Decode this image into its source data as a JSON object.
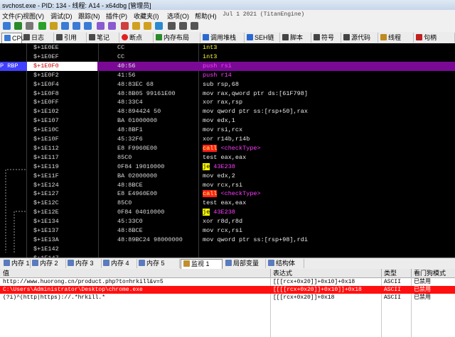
{
  "title": "svchost.exe - PID: 134 - 线程: A14 - x64dbg [管理员]",
  "menu": [
    "文件(F)",
    "视图(V)",
    "调试(D)",
    "跟踪(N)",
    "插件(P)",
    "收藏夹(I)",
    "选项(O)",
    "帮助(H)"
  ],
  "menu_date": "Jul 1 2021 (TitanEngine)",
  "tabs": [
    {
      "label": "CPU",
      "icon": "cpu-icon",
      "color": "#3a7bd5"
    },
    {
      "label": "日志",
      "icon": "log-icon",
      "color": "#4a4a4a"
    },
    {
      "label": "引用",
      "icon": "reference-icon",
      "color": "#4a4a4a"
    },
    {
      "label": "笔记",
      "icon": "notes-icon",
      "color": "#4a4a4a"
    },
    {
      "label": "断点",
      "icon": "breakpoint-icon",
      "color": "#e02020"
    },
    {
      "label": "内存布局",
      "icon": "memory-map-icon",
      "color": "#2a8a2a"
    },
    {
      "label": "调用堆栈",
      "icon": "call-stack-icon",
      "color": "#2a6ad0"
    },
    {
      "label": "SEH链",
      "icon": "seh-chain-icon",
      "color": "#2a6ad0"
    },
    {
      "label": "脚本",
      "icon": "script-icon",
      "color": "#444"
    },
    {
      "label": "符号",
      "icon": "symbols-icon",
      "color": "#444"
    },
    {
      "label": "源代码",
      "icon": "source-icon",
      "color": "#444"
    },
    {
      "label": "线程",
      "icon": "threads-icon",
      "color": "#c08a20"
    },
    {
      "label": "句柄",
      "icon": "handles-icon",
      "color": "#c02020"
    }
  ],
  "disasm": {
    "rip_label": "P RBP",
    "rows": [
      {
        "addr": "$+1E0EE",
        "bytes": "CC",
        "parts": [
          [
            "int3",
            "k-yel"
          ]
        ]
      },
      {
        "addr": "$+1E0EF",
        "bytes": "CC",
        "parts": [
          [
            "int3",
            "k-yel"
          ]
        ]
      },
      {
        "addr": "$+1E0F0",
        "bytes": "40:56",
        "parts": [
          [
            "push rsi",
            "k-mag"
          ]
        ],
        "sel": true
      },
      {
        "addr": "$+1E0F2",
        "bytes": "41:56",
        "parts": [
          [
            "push r14",
            "k-mag"
          ]
        ]
      },
      {
        "addr": "$+1E0F4",
        "bytes": "48:83EC 68",
        "parts": [
          [
            "sub rsp,68",
            "k-wht"
          ]
        ]
      },
      {
        "addr": "$+1E0F8",
        "bytes": "48:8B05 99161E00",
        "parts": [
          [
            "mov rax,qword ptr ds:[61F798]",
            "k-wht"
          ]
        ]
      },
      {
        "addr": "$+1E0FF",
        "bytes": "48:33C4",
        "parts": [
          [
            "xor rax,rsp",
            "k-wht"
          ]
        ]
      },
      {
        "addr": "$+1E102",
        "bytes": "48:894424 50",
        "parts": [
          [
            "mov qword ptr ss:[rsp+50],rax",
            "k-wht"
          ]
        ]
      },
      {
        "addr": "$+1E107",
        "bytes": "BA 01000000",
        "parts": [
          [
            "mov edx,1",
            "k-wht"
          ]
        ]
      },
      {
        "addr": "$+1E10C",
        "bytes": "48:8BF1",
        "parts": [
          [
            "mov rsi,rcx",
            "k-wht"
          ]
        ]
      },
      {
        "addr": "$+1E10F",
        "bytes": "45:32F6",
        "parts": [
          [
            "xor r14b,r14b",
            "k-wht"
          ]
        ]
      },
      {
        "addr": "$+1E112",
        "bytes": "E8 F9960E00",
        "parts": [
          [
            "call",
            "k-call"
          ],
          [
            " <checkType>",
            "k-mag"
          ]
        ]
      },
      {
        "addr": "$+1E117",
        "bytes": "85C0",
        "parts": [
          [
            "test eax,eax",
            "k-wht"
          ]
        ]
      },
      {
        "addr": "$+1E119",
        "bytes": "0F84 19010000",
        "parts": [
          [
            "je",
            "k-je"
          ],
          [
            " 43E238",
            "k-mag"
          ]
        ]
      },
      {
        "addr": "$+1E11F",
        "bytes": "BA 02000000",
        "parts": [
          [
            "mov edx,2",
            "k-wht"
          ]
        ]
      },
      {
        "addr": "$+1E124",
        "bytes": "48:8BCE",
        "parts": [
          [
            "mov rcx,rsi",
            "k-wht"
          ]
        ]
      },
      {
        "addr": "$+1E127",
        "bytes": "E8 E4960E00",
        "parts": [
          [
            "call",
            "k-call"
          ],
          [
            " <checkType>",
            "k-mag"
          ]
        ]
      },
      {
        "addr": "$+1E12C",
        "bytes": "85C0",
        "parts": [
          [
            "test eax,eax",
            "k-wht"
          ]
        ]
      },
      {
        "addr": "$+1E12E",
        "bytes": "0F84 04010000",
        "parts": [
          [
            "je",
            "k-je"
          ],
          [
            " 43E238",
            "k-mag"
          ]
        ]
      },
      {
        "addr": "$+1E134",
        "bytes": "45:33C0",
        "parts": [
          [
            "xor r8d,r8d",
            "k-wht"
          ]
        ]
      },
      {
        "addr": "$+1E137",
        "bytes": "48:8BCE",
        "parts": [
          [
            "mov rcx,rsi",
            "k-wht"
          ]
        ]
      },
      {
        "addr": "$+1E13A",
        "bytes": "48:89BC24 98000000",
        "parts": [
          [
            "mov qword ptr ss:[rsp+98],rdi",
            "k-wht"
          ]
        ]
      },
      {
        "addr": "$+1E142",
        "bytes": "",
        "parts": []
      },
      {
        "addr": "$+1E147",
        "bytes": "",
        "parts": []
      }
    ]
  },
  "bottom_tabs": [
    {
      "label": "内存 1"
    },
    {
      "label": "内存 2"
    },
    {
      "label": "内存 3"
    },
    {
      "label": "内存 4"
    },
    {
      "label": "内存 5"
    },
    {
      "label": "监视 1"
    },
    {
      "label": "局部变量"
    },
    {
      "label": "结构体"
    }
  ],
  "watch": {
    "headers": {
      "value": "值",
      "expr": "表达式",
      "type": "类型",
      "mode": "看门狗模式"
    },
    "rows": [
      {
        "value": "http://www.huorong.cn/product.php?to=hrkill&v=5",
        "expr": "[[[rcx+0x20]]+0x10]+0x18",
        "type": "ASCII",
        "mode": "已禁用",
        "hl": false
      },
      {
        "value": "C:\\Users\\Administrator\\Desktop\\chrome.exe",
        "expr": "[[[[rcx+0x20]]+0x10]]+0x18",
        "type": "ASCII",
        "mode": "已禁用",
        "hl": true
      },
      {
        "value": "(?i)^(http|https)://.*hrkill.*",
        "expr": "[[[rcx+0x20]]+0x18",
        "type": "ASCII",
        "mode": "已禁用",
        "hl": false
      }
    ]
  }
}
